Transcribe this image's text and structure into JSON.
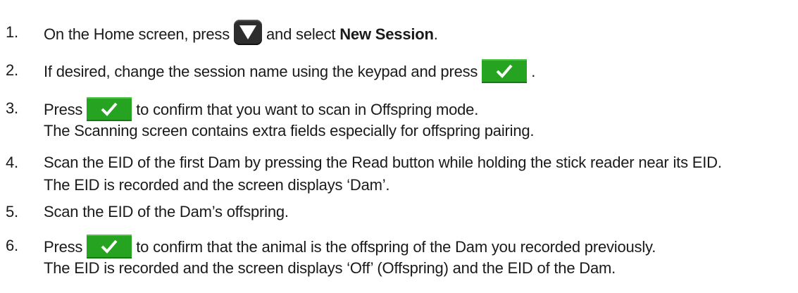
{
  "steps": [
    {
      "num": "1.",
      "before": "On the Home screen, press",
      "after": "and select",
      "bold": "New Session",
      "end": ".",
      "icon": "down-triangle-icon"
    },
    {
      "num": "2.",
      "before": "If desired, change the session name using the keypad and press",
      "end": ".",
      "icon": "checkmark-icon"
    },
    {
      "num": "3.",
      "before": "Press",
      "after": "to confirm that you want to scan in Offspring mode.",
      "sub": "The Scanning screen contains extra fields especially for offspring pairing.",
      "icon": "checkmark-icon"
    },
    {
      "num": "4.",
      "text": "Scan the EID of the first Dam by pressing the Read button while holding the stick reader near its EID.",
      "sub": "The EID is recorded and the screen displays ‘Dam’."
    },
    {
      "num": "5.",
      "text": "Scan the EID of the Dam’s offspring."
    },
    {
      "num": "6.",
      "before": "Press",
      "after": "to confirm that the animal is the offspring of the Dam you recorded previously.",
      "sub": "The EID is recorded and the screen displays ‘Off’ (Offspring) and the EID of the Dam.",
      "icon": "checkmark-icon"
    }
  ],
  "colors": {
    "confirm_button": "#26a320",
    "menu_button": "#2d2d2d"
  }
}
